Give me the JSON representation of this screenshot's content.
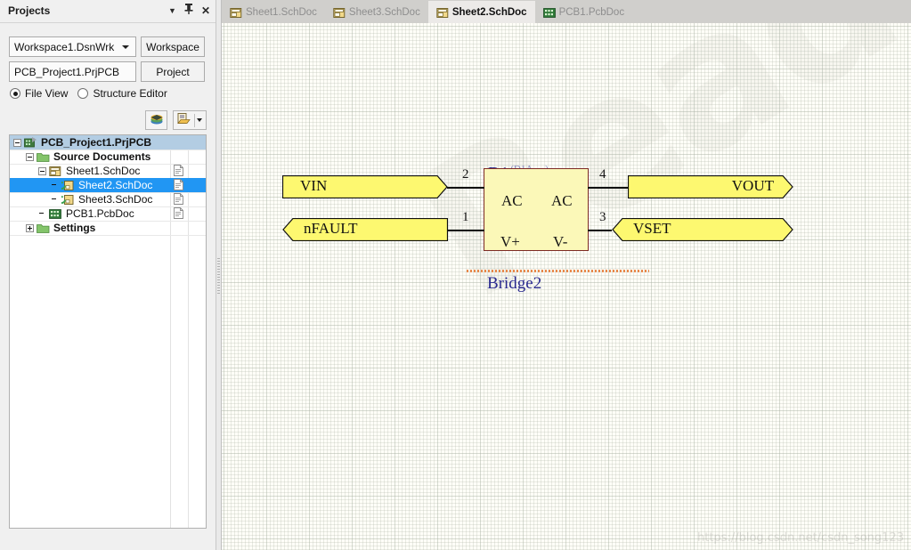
{
  "panel": {
    "title": "Projects",
    "title_buttons": [
      {
        "name": "panel-menu-caret",
        "glyph": "▼"
      },
      {
        "name": "panel-pin",
        "glyph": "⊥"
      },
      {
        "name": "panel-close",
        "glyph": "✕"
      }
    ],
    "workspace_combo": {
      "value": "Workspace1.DsnWrk"
    },
    "workspace_button": {
      "label": "Workspace"
    },
    "project_textbox": {
      "value": "PCB_Project1.PrjPCB"
    },
    "project_button": {
      "label": "Project"
    },
    "view_modes": [
      {
        "label": "File View",
        "selected": true
      },
      {
        "label": "Structure Editor",
        "selected": false
      }
    ],
    "toolbar": [
      {
        "name": "compile-icon",
        "title": ""
      },
      {
        "name": "document-options-icon",
        "title": ""
      }
    ],
    "tree": [
      {
        "label": "PCB_Project1.PrjPCB",
        "indent": 0,
        "expander": "minus",
        "icon": "pcb-project",
        "bold": true,
        "selected": "light",
        "doc": false
      },
      {
        "label": "Source Documents",
        "indent": 1,
        "expander": "minus",
        "icon": "folder",
        "bold": true,
        "selected": "none",
        "doc": false
      },
      {
        "label": "Sheet1.SchDoc",
        "indent": 2,
        "expander": "minus",
        "icon": "sch-sheet",
        "bold": false,
        "selected": "none",
        "doc": true
      },
      {
        "label": "Sheet2.SchDoc",
        "indent": 3,
        "expander": "none",
        "icon": "sch-sub",
        "bold": false,
        "selected": "strong",
        "doc": true
      },
      {
        "label": "Sheet3.SchDoc",
        "indent": 3,
        "expander": "none",
        "icon": "sch-sub",
        "bold": false,
        "selected": "none",
        "doc": true
      },
      {
        "label": "PCB1.PcbDoc",
        "indent": 2,
        "expander": "none",
        "icon": "pcb-doc",
        "bold": false,
        "selected": "none",
        "doc": true
      },
      {
        "label": "Settings",
        "indent": 1,
        "expander": "plus",
        "icon": "folder",
        "bold": true,
        "selected": "none",
        "doc": false
      }
    ]
  },
  "tabs": [
    {
      "label": "Sheet1.SchDoc",
      "icon": "sch-doc-icon",
      "active": false
    },
    {
      "label": "Sheet3.SchDoc",
      "icon": "sch-doc-icon",
      "active": false
    },
    {
      "label": "Sheet2.SchDoc",
      "icon": "sch-doc-icon",
      "active": true
    },
    {
      "label": "PCB1.PcbDoc",
      "icon": "pcb-doc-icon",
      "active": false
    }
  ],
  "schematic": {
    "component": {
      "designator": "D1",
      "designator_sub": "(D1A, ...)",
      "name": "Bridge2",
      "pins": [
        {
          "name": "AC",
          "number": "2",
          "side": "left",
          "row": "top"
        },
        {
          "name": "V+",
          "number": "1",
          "side": "left",
          "row": "bottom"
        },
        {
          "name": "AC",
          "number": "4",
          "side": "right",
          "row": "top"
        },
        {
          "name": "V-",
          "number": "3",
          "side": "right",
          "row": "bottom"
        }
      ]
    },
    "ports": [
      {
        "label": "VIN",
        "style": "right-arrow",
        "align": "left"
      },
      {
        "label": "nFAULT",
        "style": "left-arrow",
        "align": "left"
      },
      {
        "label": "VOUT",
        "style": "right-arrow",
        "align": "right"
      },
      {
        "label": "VSET",
        "style": "bidirectional",
        "align": "left"
      }
    ],
    "watermark_big": "ReadO",
    "watermark_url": "https://blog.csdn.net/csdn_song123"
  },
  "colors": {
    "component_fill": "#fbf8b8",
    "component_border": "#7d2b25",
    "port_fill": "#fdf870",
    "designator": "#2a2a8f",
    "selection": "#2196f3",
    "canvas": "#fffef8"
  }
}
